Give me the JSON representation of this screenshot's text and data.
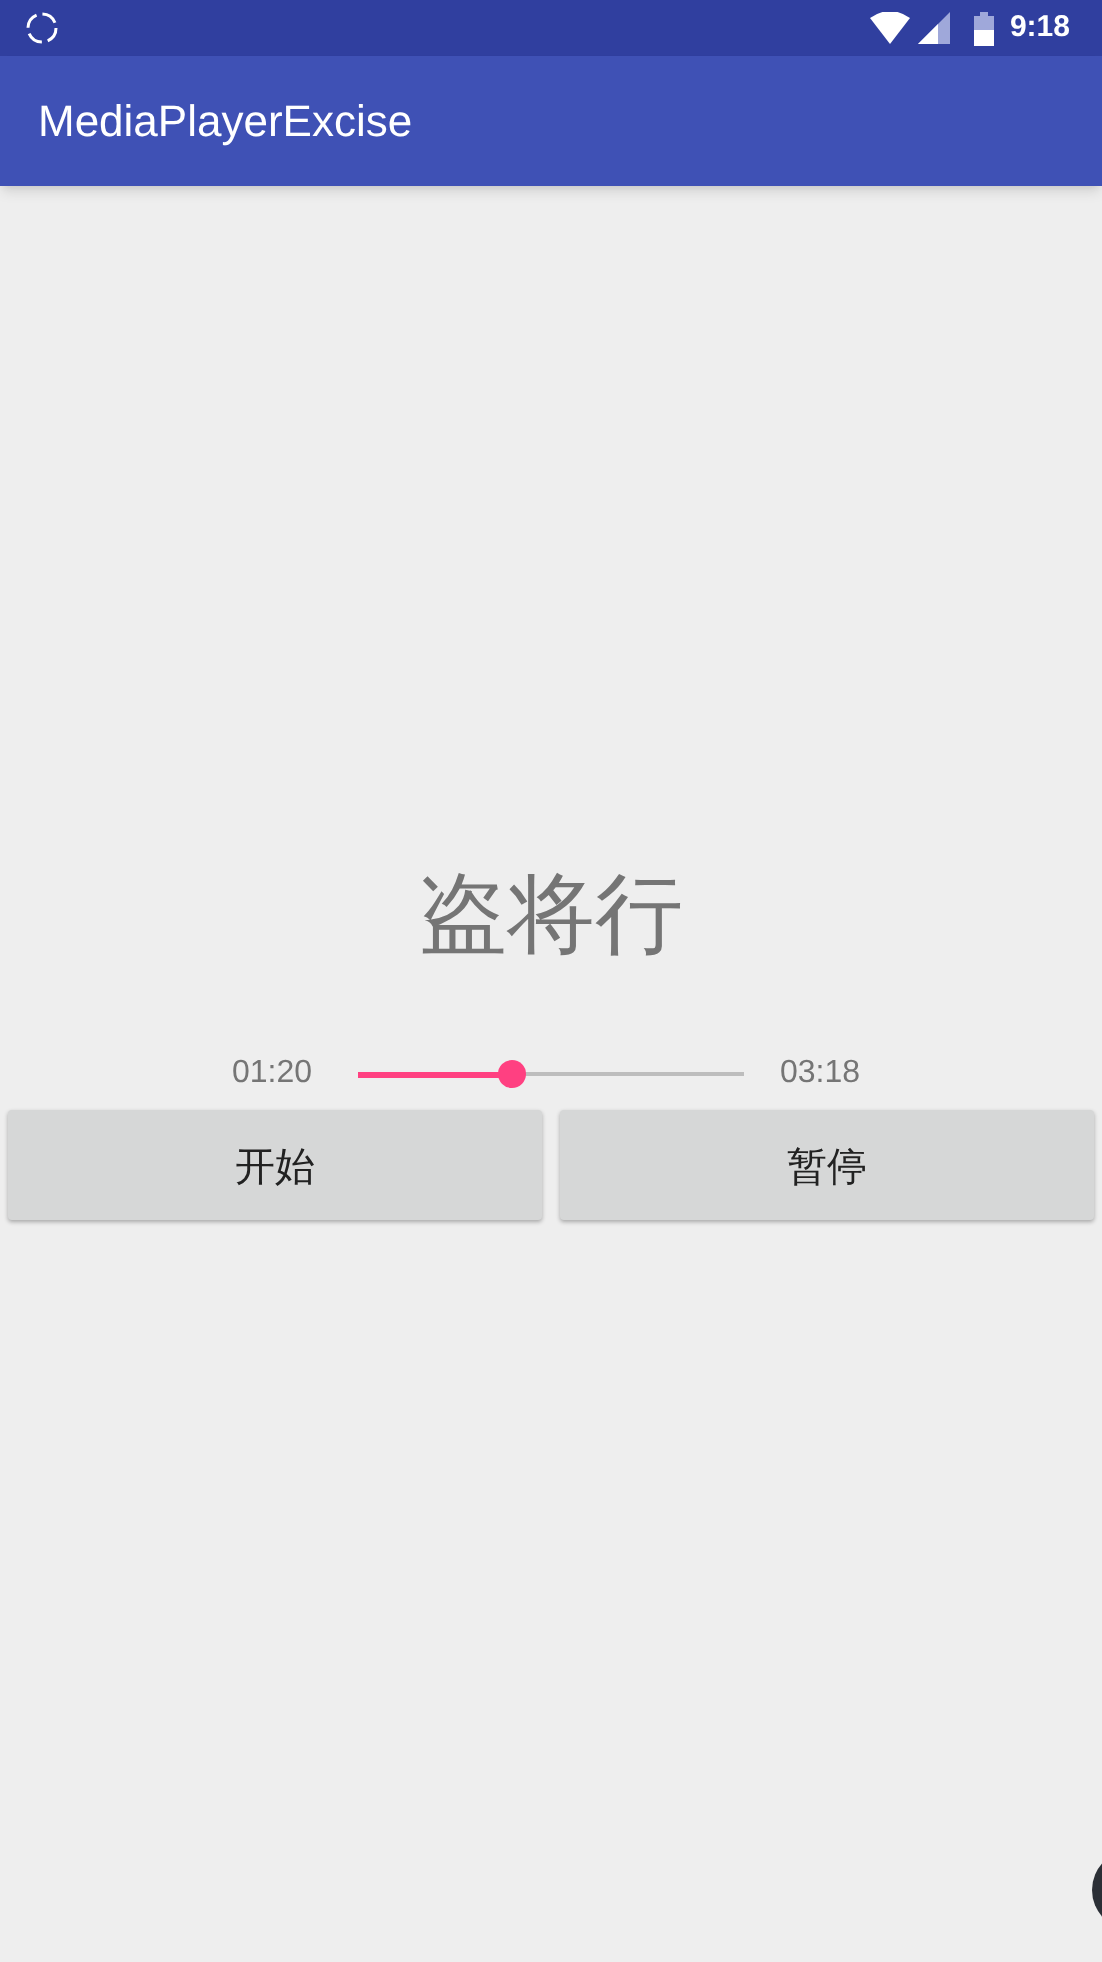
{
  "status_bar": {
    "time": "9:18"
  },
  "app_bar": {
    "title": "MediaPlayerExcise"
  },
  "song_title": "盗将行",
  "player": {
    "elapsed": "01:20",
    "duration": "03:18",
    "level": 0.4
  },
  "buttons": [
    {
      "label": "开始"
    },
    {
      "label": "暂停"
    }
  ]
}
